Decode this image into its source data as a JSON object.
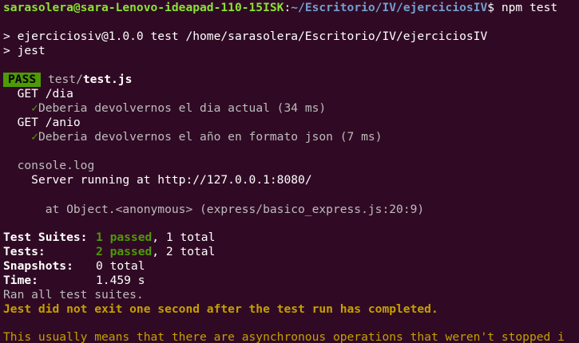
{
  "prompt": {
    "user_host": "sarasolera@sara-Lenovo-ideapad-110-15ISK",
    "sep": ":",
    "path": "~/Escritorio/IV/ejerciciosIV",
    "symbol": "$",
    "command": " npm test"
  },
  "script_line": "> ejerciciosiv@1.0.0 test /home/sarasolera/Escritorio/IV/ejerciciosIV",
  "jest_line": "> jest",
  "result": {
    "badge": "PASS",
    "dir": "test/",
    "file": "test.js"
  },
  "suites": [
    {
      "name": "GET /dia",
      "check": "✓",
      "test": "Deberia devolvernos el dia actual (34 ms)"
    },
    {
      "name": "GET /anio",
      "check": "✓",
      "test": "Deberia devolvernos el año en formato json (7 ms)"
    }
  ],
  "console": {
    "label": "console.log",
    "message": "Server running at http://127.0.0.1:8080/",
    "location": "at Object.<anonymous> (express/basico_express.js:20:9)"
  },
  "summary": {
    "suites_label": "Test Suites:",
    "suites_passed": "1 passed",
    "suites_total": ", 1 total",
    "tests_label": "Tests:",
    "tests_passed": "2 passed",
    "tests_total": ", 2 total",
    "snapshots_label": "Snapshots:",
    "snapshots_value": "0 total",
    "time_label": "Time:",
    "time_value": "1.459 s",
    "ran": "Ran all test suites."
  },
  "warning": "Jest did not exit one second after the test run has completed.",
  "warning_detail": "This usually means that there are asynchronous operations that weren't stopped i"
}
